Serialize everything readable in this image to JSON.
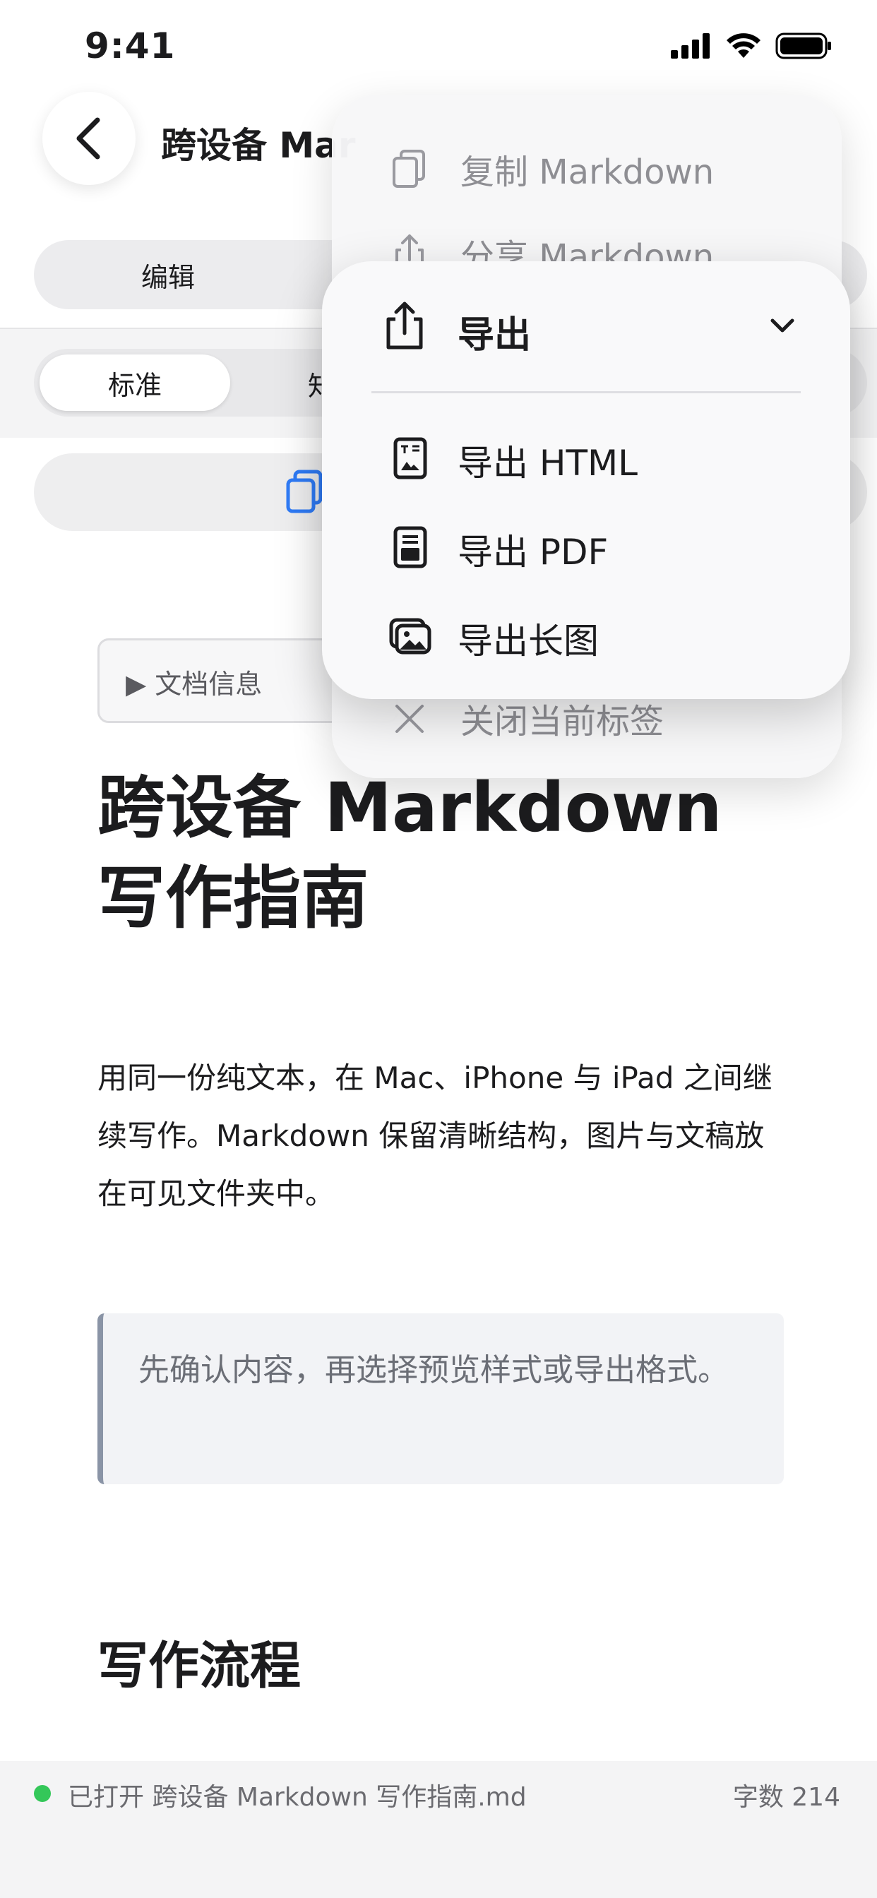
{
  "status_bar": {
    "time": "9:41"
  },
  "header": {
    "back_icon": "chevron-left-icon",
    "title": "跨设备 Mar",
    "mode_tabs": [
      {
        "label": "编辑"
      }
    ]
  },
  "style_tabs": [
    {
      "label": "标准",
      "selected": true
    },
    {
      "label": "知"
    }
  ],
  "copy_bar": {
    "icon": "copy-icon",
    "accent": "#2f7bf6"
  },
  "document": {
    "info_toggle": "▶ 文档信息",
    "heading": "跨设备 Markdown 写作指南",
    "paragraph": "用同一份纯文本，在 Mac、iPhone 与 iPad 之间继续写作。Markdown 保留清晰结构，图片与文稿放在可见文件夹中。",
    "quote": "先确认内容，再选择预览样式或导出格式。",
    "subheading": "写作流程"
  },
  "bottom_status": {
    "file": "已打开 跨设备 Markdown 写作指南.md",
    "word_count": "字数 214",
    "status_color": "#34c759"
  },
  "menu_back": {
    "items": [
      {
        "label": "复制 Markdown",
        "icon": "copy-doc-icon"
      },
      {
        "label": "分享 Markdown",
        "icon": "share-icon"
      },
      {
        "label": "关闭当前标签",
        "icon": "close-icon"
      }
    ]
  },
  "menu_front": {
    "header": {
      "label": "导出",
      "icon": "export-icon"
    },
    "items": [
      {
        "label": "导出 HTML",
        "icon": "html-doc-icon"
      },
      {
        "label": "导出 PDF",
        "icon": "pdf-doc-icon"
      },
      {
        "label": "导出长图",
        "icon": "long-image-icon"
      }
    ]
  }
}
